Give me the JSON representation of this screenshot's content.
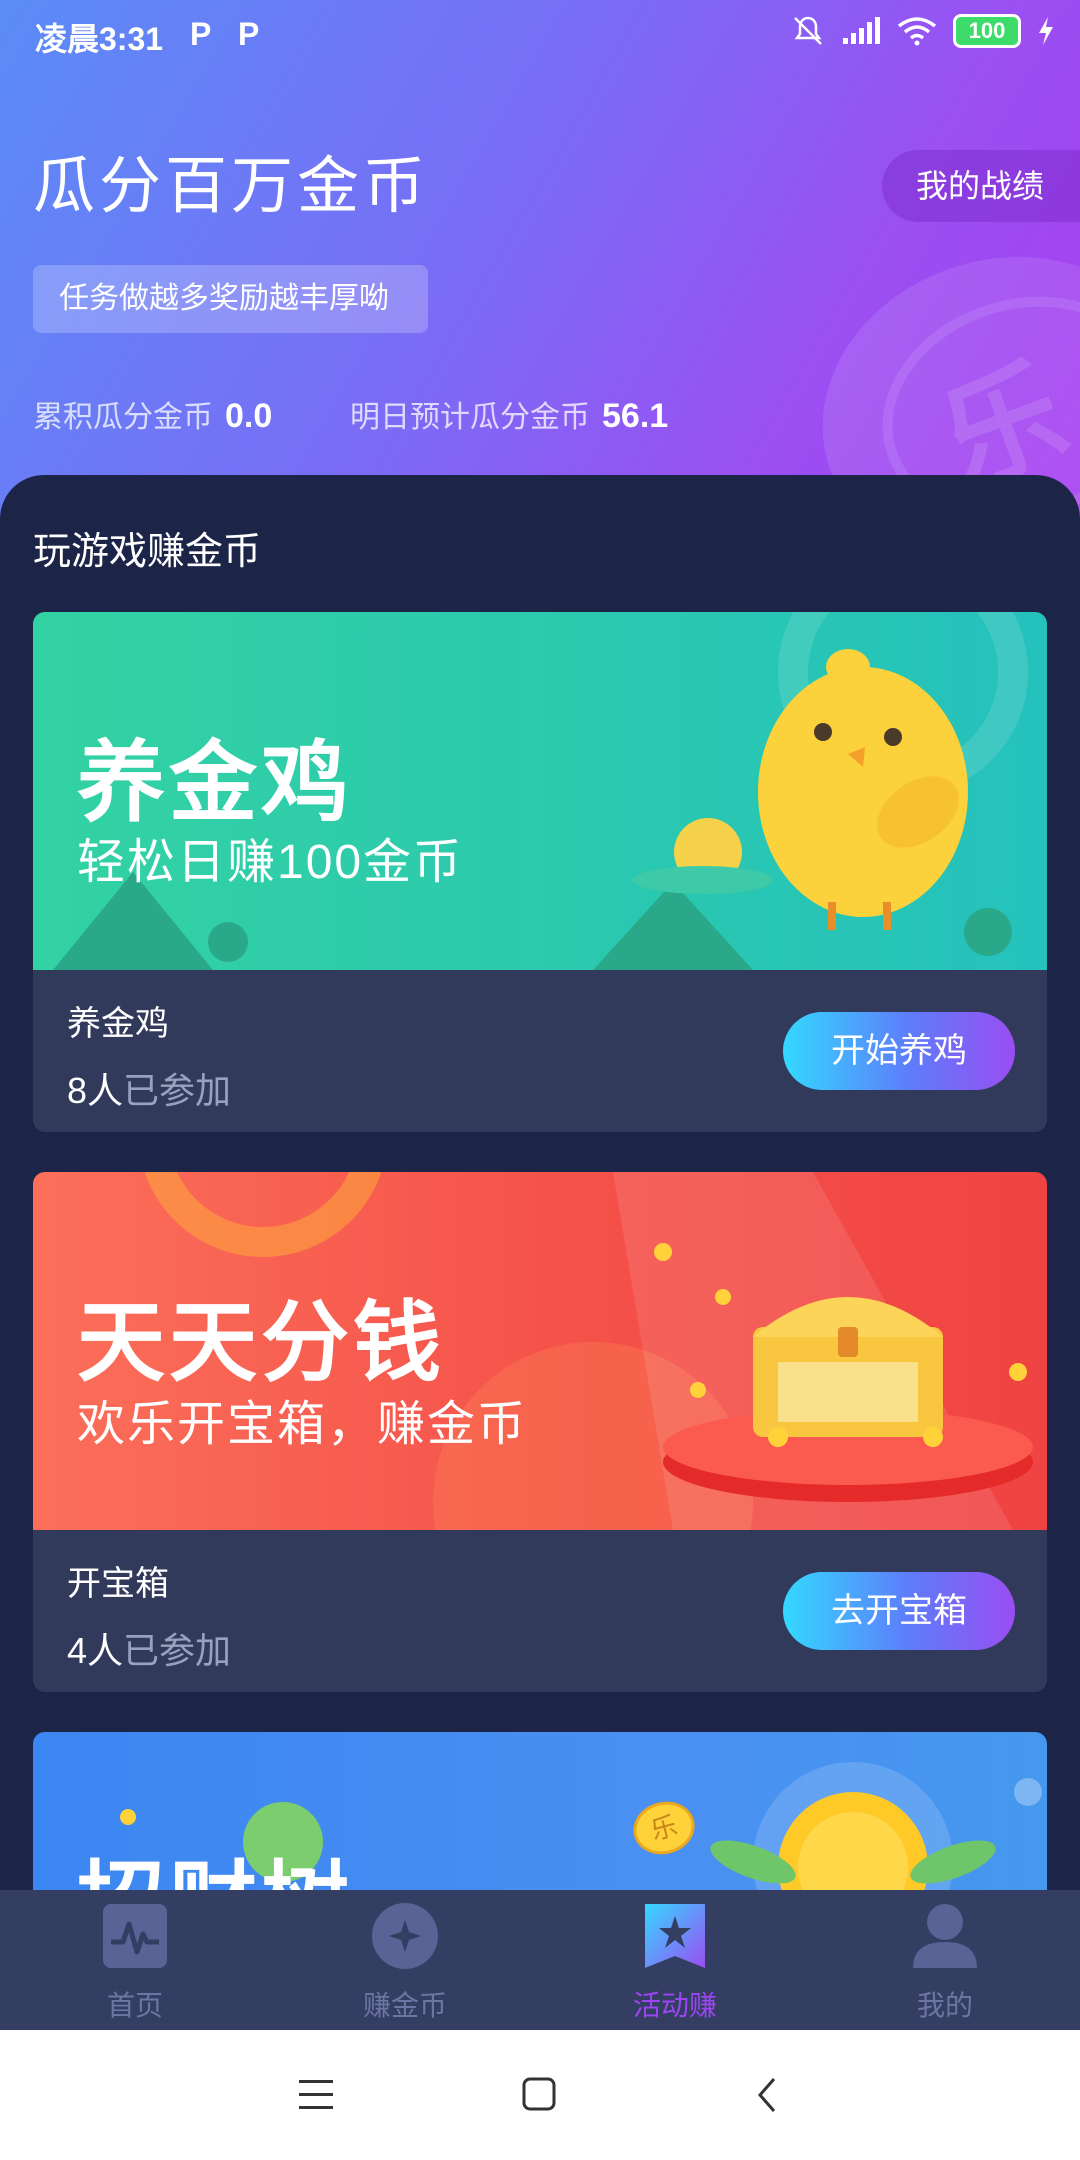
{
  "status_bar": {
    "time": "凌晨3:31",
    "notif_icons": [
      "P",
      "P"
    ],
    "battery": "100"
  },
  "header": {
    "title": "瓜分百万金币",
    "record_button": "我的战绩",
    "subtitle": "任务做越多奖励越丰厚呦",
    "stat_total_label": "累积瓜分金币",
    "stat_total_value": "0.0",
    "stat_tomorrow_label": "明日预计瓜分金币",
    "stat_tomorrow_value": "56.1"
  },
  "section": {
    "title": "玩游戏赚金币"
  },
  "cards": [
    {
      "banner_title": "养金鸡",
      "banner_sub": "轻松日赚100金币",
      "name": "养金鸡",
      "count": "8人",
      "count_tail": "已参加",
      "button": "开始养鸡"
    },
    {
      "banner_title": "天天分钱",
      "banner_sub": "欢乐开宝箱，赚金币",
      "name": "开宝箱",
      "count": "4人",
      "count_tail": "已参加",
      "button": "去开宝箱"
    },
    {
      "banner_title": "招财树",
      "coin_char": "乐"
    }
  ],
  "tabs": [
    {
      "label": "首页",
      "icon": "pulse-icon"
    },
    {
      "label": "赚金币",
      "icon": "star-coin-icon"
    },
    {
      "label": "活动赚",
      "icon": "star-flag-icon"
    },
    {
      "label": "我的",
      "icon": "user-icon"
    }
  ],
  "colors": {
    "accent": "#9d45f3",
    "tab_inactive": "#6d76a3",
    "card_bg": "#323a5c",
    "page_bg": "#1c2447"
  }
}
